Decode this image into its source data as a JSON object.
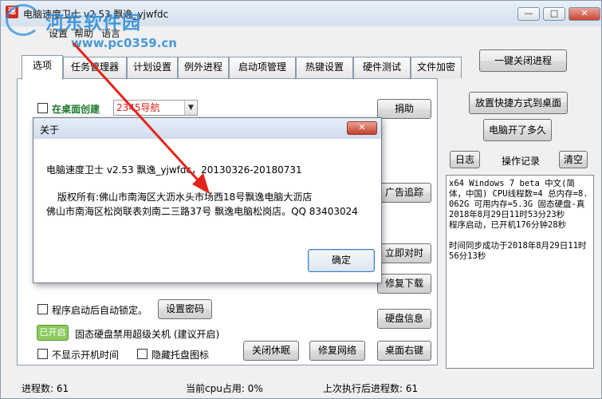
{
  "window": {
    "app_icon": "速",
    "title": "电脑速度卫士 v2.53   飘逸_yjwfdc",
    "buttons": {
      "minimize": "—",
      "maximize": "□",
      "close": "✕"
    }
  },
  "watermark": {
    "text": "河东软件园",
    "url": "www.pc0359.cn"
  },
  "menu": [
    "设置",
    "帮助",
    "语言"
  ],
  "tabs": [
    "选项",
    "任务管理器",
    "计划设置",
    "例外进程",
    "启动项管理",
    "热键设置",
    "硬件测试",
    "文件加密"
  ],
  "top_right_button": "一键关闭进程",
  "main": {
    "desktop_create_label": "在桌面创建",
    "select_value": "2345导航",
    "donate_button": "捐助",
    "ad_track_button": "广告追踪",
    "sync_time_button": "立即对时",
    "repair_download_button": "修复下载",
    "disk_info_button": "硬盘信息",
    "auto_lock_label": "程序启动后自动锁定。",
    "set_password_button": "设置密码",
    "toggle_label": "已开启",
    "ssd_label": "固态硬盘禁用超级关机 (建议开启)",
    "hide_boot_time_label": "不显示开机时间",
    "hide_tray_label": "隐藏托盘图标",
    "close_hibernate_button": "关闭休眠",
    "repair_network_button": "修复网络",
    "desktop_right_button": "桌面右键"
  },
  "right_panel": {
    "place_shortcut_button": "放置快捷方式到桌面",
    "uptime_button": "电脑开了多久",
    "log_button": "日志",
    "log_title": "操作记录",
    "clear_button": "清空",
    "log_lines": [
      "x64 Windows 7 beta  中文(简体，中国) CPU线程数=4 总内存=8.062G 可用内存=5.3G 固态硬盘-真",
      " 2018年8月29日11时53分23秒",
      " 程序启动，已开机176分钟28秒",
      "",
      "时间同步成功于2018年8月29日11时56分13秒"
    ]
  },
  "status": {
    "process_count": "进程数: 61",
    "cpu_usage": "当前cpu占用: 0%",
    "last_exec": "上次执行后进程数: 61"
  },
  "dialog": {
    "title": "关于",
    "close": "✕",
    "line1": "电脑速度卫士 v2.53  飘逸_yjwfdc，20130326-20180731",
    "line2": "版权所有:佛山市南海区大沥水头市场西18号飘逸电脑大沥店",
    "line3": "佛山市南海区松岗联表刘南二三路37号 飘逸电脑松岗店。QQ 83403024",
    "ok_button": "确定"
  }
}
